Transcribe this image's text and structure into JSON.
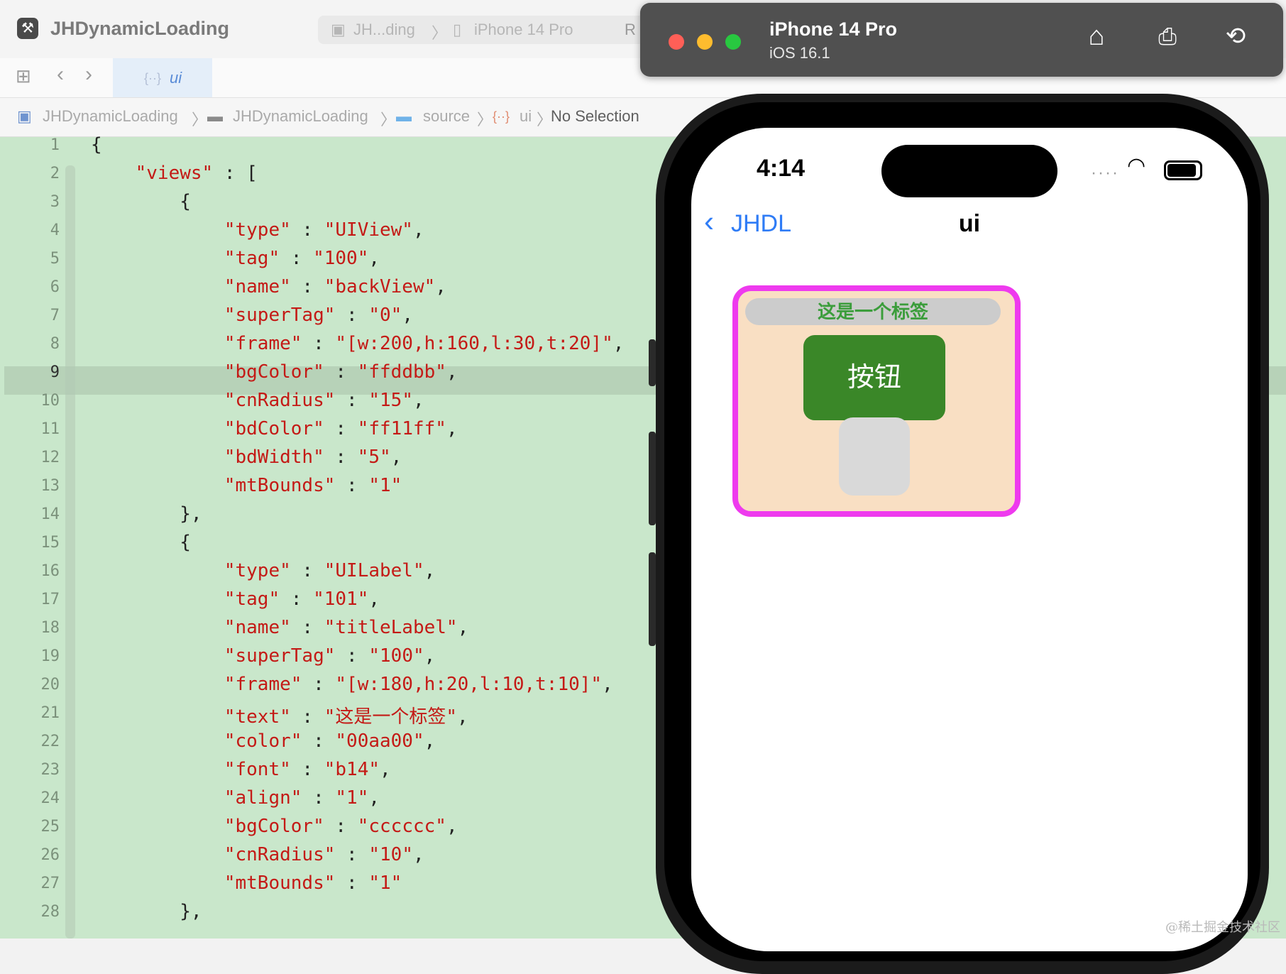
{
  "toolbar": {
    "app_title": "JHDynamicLoading",
    "scheme_project": "JH...ding",
    "scheme_device": "iPhone 14 Pro",
    "scheme_extra": "R"
  },
  "tab": {
    "label": "ui",
    "icon": "json-braces-icon"
  },
  "breadcrumb": {
    "project": "JHDynamicLoading",
    "group": "JHDynamicLoading",
    "folder": "source",
    "file": "ui",
    "selection": "No Selection"
  },
  "editor": {
    "active_line": 9,
    "lines": [
      "{",
      "    \"views\" : [",
      "        {",
      "            \"type\" : \"UIView\",",
      "            \"tag\" : \"100\",",
      "            \"name\" : \"backView\",",
      "            \"superTag\" : \"0\",",
      "            \"frame\" : \"[w:200,h:160,l:30,t:20]\",",
      "            \"bgColor\" : \"ffddbb\",",
      "            \"cnRadius\" : \"15\",",
      "            \"bdColor\" : \"ff11ff\",",
      "            \"bdWidth\" : \"5\",",
      "            \"mtBounds\" : \"1\"",
      "        },",
      "        {",
      "            \"type\" : \"UILabel\",",
      "            \"tag\" : \"101\",",
      "            \"name\" : \"titleLabel\",",
      "            \"superTag\" : \"100\",",
      "            \"frame\" : \"[w:180,h:20,l:10,t:10]\",",
      "            \"text\" : \"这是一个标签\",",
      "            \"color\" : \"00aa00\",",
      "            \"font\" : \"b14\",",
      "            \"align\" : \"1\",",
      "            \"bgColor\" : \"cccccc\",",
      "            \"cnRadius\" : \"10\",",
      "            \"mtBounds\" : \"1\"",
      "        },"
    ]
  },
  "simulator": {
    "device": "iPhone 14 Pro",
    "os": "iOS 16.1",
    "colors": {
      "close": "#ff5f57",
      "minimize": "#febc2e",
      "zoom": "#28c840"
    }
  },
  "phone": {
    "time": "4:14",
    "back_label": "JHDL",
    "nav_title": "ui",
    "label_text": "这是一个标签",
    "button_label": "按钮",
    "colors": {
      "backview_bg": "#ffddbb",
      "backview_border": "#ff11ff",
      "label_bg": "#cccccc",
      "label_text": "#00aa00",
      "button_bg": "#3a8728",
      "link": "#2f7cf6"
    }
  },
  "watermark": "@稀土掘金技术社区"
}
